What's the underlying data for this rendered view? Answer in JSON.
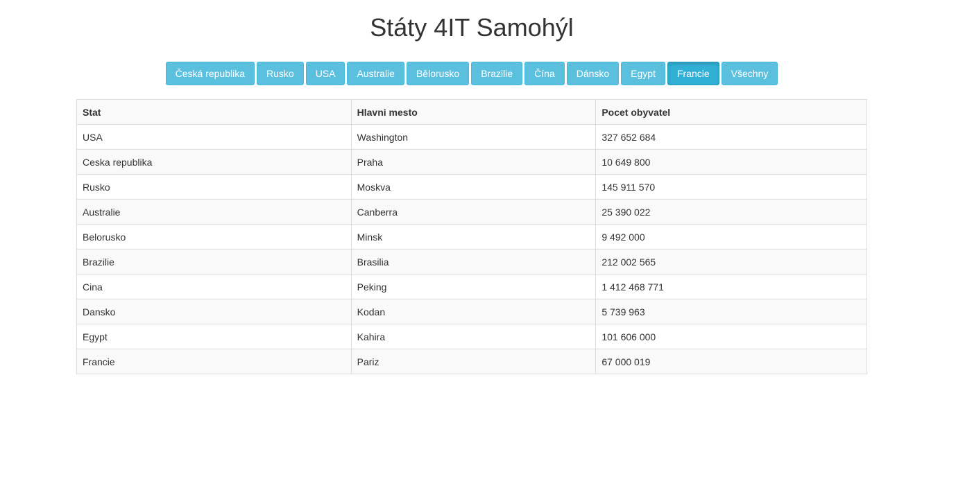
{
  "page": {
    "title": "Státy 4IT Samohýl"
  },
  "filter_buttons": [
    {
      "label": "Česká republika",
      "active": false
    },
    {
      "label": "Rusko",
      "active": false
    },
    {
      "label": "USA",
      "active": false
    },
    {
      "label": "Australie",
      "active": false
    },
    {
      "label": "Bělorusko",
      "active": false
    },
    {
      "label": "Brazilie",
      "active": false
    },
    {
      "label": "Čína",
      "active": false
    },
    {
      "label": "Dánsko",
      "active": false
    },
    {
      "label": "Egypt",
      "active": false
    },
    {
      "label": "Francie",
      "active": true
    },
    {
      "label": "Všechny",
      "active": false
    }
  ],
  "table": {
    "headers": [
      "Stat",
      "Hlavni mesto",
      "Pocet obyvatel"
    ],
    "rows": [
      [
        "USA",
        "Washington",
        "327 652 684"
      ],
      [
        "Ceska republika",
        "Praha",
        "10 649 800"
      ],
      [
        "Rusko",
        "Moskva",
        "145 911 570"
      ],
      [
        "Australie",
        "Canberra",
        "25 390 022"
      ],
      [
        "Belorusko",
        "Minsk",
        "9 492 000"
      ],
      [
        "Brazilie",
        "Brasilia",
        "212 002 565"
      ],
      [
        "Cina",
        "Peking",
        "1 412 468 771"
      ],
      [
        "Dansko",
        "Kodan",
        "5 739 963"
      ],
      [
        "Egypt",
        "Kahira",
        "101 606 000"
      ],
      [
        "Francie",
        "Pariz",
        "67 000 019"
      ]
    ]
  },
  "colors": {
    "button_bg": "#5bc0de",
    "button_active_bg": "#31b0d5",
    "table_border": "#dddddd",
    "stripe": "#f9f9f9"
  }
}
